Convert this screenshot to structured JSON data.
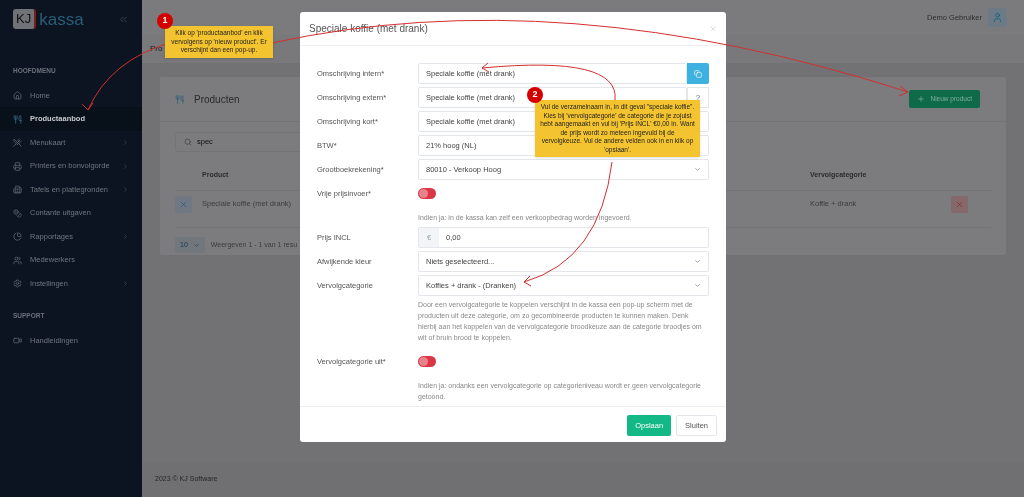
{
  "sidebar": {
    "logo_mark": "KJ",
    "logo_text": "kassa",
    "sections": [
      {
        "title": "HOOFDMENU",
        "items": [
          {
            "label": "Home",
            "selected": false,
            "expandable": false
          },
          {
            "label": "Productaanbod",
            "selected": true,
            "expandable": false
          },
          {
            "label": "Menukaart",
            "selected": false,
            "expandable": true
          },
          {
            "label": "Printers en bonvolgorde",
            "selected": false,
            "expandable": true
          },
          {
            "label": "Tafels en plattegronden",
            "selected": false,
            "expandable": true
          },
          {
            "label": "Contante uitgaven",
            "selected": false,
            "expandable": false
          },
          {
            "label": "Rapportages",
            "selected": false,
            "expandable": true
          },
          {
            "label": "Medewerkers",
            "selected": false,
            "expandable": false
          },
          {
            "label": "Instellingen",
            "selected": false,
            "expandable": true
          }
        ]
      },
      {
        "title": "SUPPORT",
        "items": [
          {
            "label": "Handleidingen",
            "selected": false,
            "expandable": false
          }
        ]
      }
    ]
  },
  "topbar": {
    "user": "Demo Gebruiker"
  },
  "page_title": "Pro",
  "card": {
    "title": "Producten",
    "new_button": "Nieuw product",
    "search": {
      "value": "spec"
    },
    "columns": [
      "Product",
      "Vervolgcategorie"
    ],
    "rows": [
      {
        "product": "Speciale koffie (met drank)",
        "category": "Koffie + drank"
      }
    ],
    "page_size": "10",
    "summary": "Weergeven 1 - 1 van 1 resu"
  },
  "footer": "2023 © KJ Software",
  "modal": {
    "title": "Speciale koffie (met drank)",
    "fields": [
      {
        "kind": "text",
        "label": "Omschrijving intern*",
        "value": "Speciale koffie (met drank)",
        "addon": {
          "kind": "copy"
        }
      },
      {
        "kind": "text",
        "label": "Omschrijving extern*",
        "value": "Speciale koffie (met drank)",
        "addon": {
          "kind": "help",
          "text": "?"
        }
      },
      {
        "kind": "text",
        "label": "Omschrijving kort*",
        "value": "Speciale koffie (met drank)"
      },
      {
        "kind": "text",
        "label": "BTW*",
        "value": "21% hoog (NL)"
      },
      {
        "kind": "select",
        "label": "Grootboekrekening*",
        "value": "80010 - Verkoop Hoog"
      },
      {
        "kind": "toggle",
        "label": "Vrije prijsinvoer*",
        "on": false,
        "help": "Indien ja: in de kassa kan zelf een verkoopbedrag worden ingevoerd."
      },
      {
        "kind": "price",
        "label": "Prijs INCL",
        "prefix": "€",
        "value": "0,00"
      },
      {
        "kind": "select",
        "label": "Afwijkende kleur",
        "value": "Niets geselecteerd..."
      },
      {
        "kind": "select",
        "label": "Vervolgcategorie",
        "value": "Koffies + drank - (Dranken)",
        "help": "Door een vervolgcategorie te koppelen verschijnt in de kassa een pop-up scherm met de producten uit deze categorie, om zo gecombineerde producten te kunnen maken. Denk hierbij aan het koppelen van de vervolgcategorie broodkeuze aan de categorie broodjes om wit of bruin brood te koppelen."
      },
      {
        "kind": "toggle",
        "label": "Vervolgcategorie uit*",
        "on": false,
        "help": "Indien ja: ondanks een vervolgcategorie op categorieniveau wordt er geen vervolgcategorie getoond."
      }
    ],
    "buttons": [
      {
        "label": "Opslaan",
        "kind": "primary"
      },
      {
        "label": "Sluiten",
        "kind": "secondary"
      }
    ]
  },
  "callouts": [
    {
      "number": "1",
      "text": "Klik op 'productaanbod' en klik vervolgens op 'nieuw product'. Er verschijnt dan een pop-up."
    },
    {
      "number": "2",
      "text": "Vul de verzamelnaam in, in dit geval \"speciale koffie\". Kies bij 'vervolgcategorie' de categorie die je zojuist hebt aangemaakt en vul bij 'Prijs INCL' €0,00 in. Want de prijs wordt zo meteen ingevuld bij de vervolgkeuze. Vul de andere velden ook in en klik op 'opslaan'."
    }
  ]
}
